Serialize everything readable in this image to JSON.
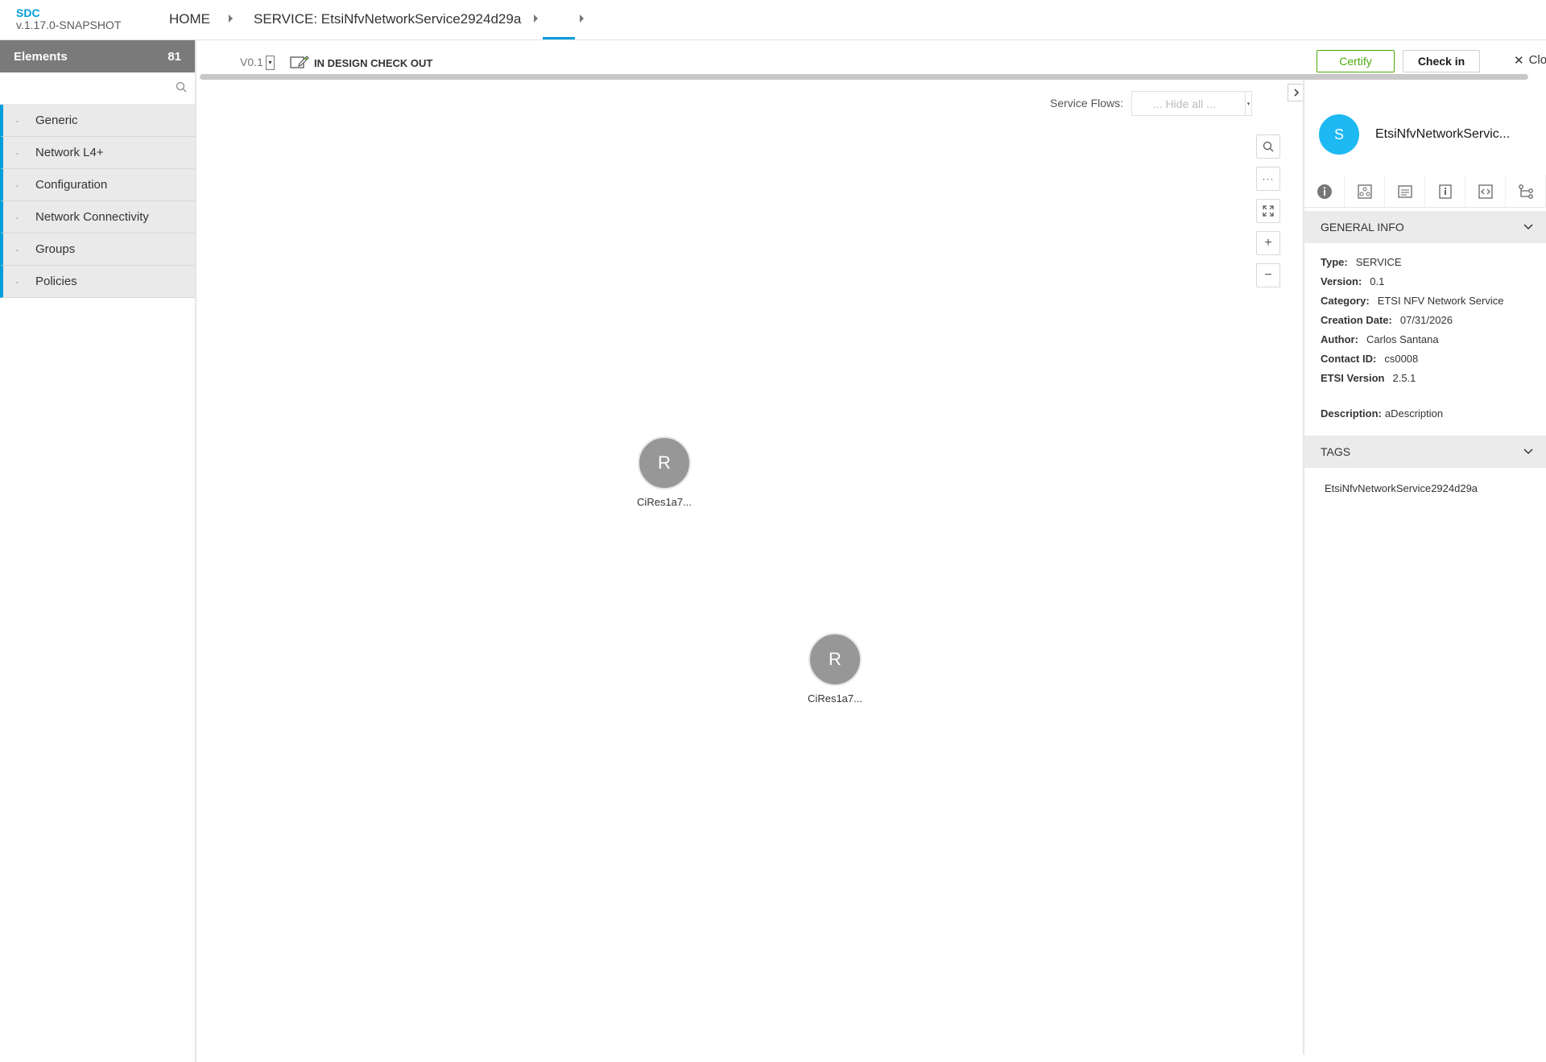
{
  "app": {
    "name": "SDC",
    "version": "v.1.17.0-SNAPSHOT"
  },
  "breadcrumb": {
    "home": "HOME",
    "service": "SERVICE: EtsiNfvNetworkService2924d29a"
  },
  "palette": {
    "title": "Elements",
    "count": "81",
    "search_placeholder": "",
    "categories": [
      "Generic",
      "Network L4+",
      "Configuration",
      "Network Connectivity",
      "Groups",
      "Policies"
    ]
  },
  "toolbar": {
    "version": "V0.1",
    "status": "IN DESIGN CHECK OUT",
    "certify_label": "Certify",
    "checkin_label": "Check in",
    "close_label": "Clo"
  },
  "canvas": {
    "flows_label": "Service Flows:",
    "flows_value": "... Hide all ...",
    "nodes": [
      {
        "letter": "R",
        "label": "CiRes1a7..."
      },
      {
        "letter": "R",
        "label": "CiRes1a7..."
      }
    ]
  },
  "details": {
    "avatar_letter": "S",
    "title": "EtsiNfvNetworkServic...",
    "tabs": [
      "info-icon",
      "composition-icon",
      "artifacts-icon",
      "properties-icon",
      "api-icon",
      "paths-icon"
    ],
    "general_info_title": "GENERAL INFO",
    "fields": [
      {
        "label": "Type:",
        "value": "SERVICE"
      },
      {
        "label": "Version:",
        "value": "0.1"
      },
      {
        "label": "Category:",
        "value": "ETSI NFV Network Service"
      },
      {
        "label": "Creation Date:",
        "value": "07/31/2026"
      },
      {
        "label": "Author:",
        "value": "Carlos Santana"
      },
      {
        "label": "Contact ID:",
        "value": "cs0008"
      },
      {
        "label": "ETSI Version",
        "value": "2.5.1"
      }
    ],
    "description_label": "Description:",
    "description_value": "aDescription",
    "tags_title": "TAGS",
    "tags": [
      "EtsiNfvNetworkService2924d29a"
    ]
  },
  "colors": {
    "accent": "#009fdb",
    "certify": "#4ca90c",
    "avatar": "#1eb9f3",
    "node": "#979797"
  }
}
